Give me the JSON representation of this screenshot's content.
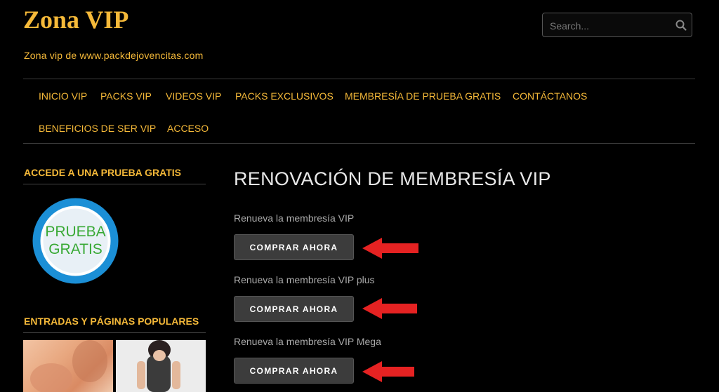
{
  "site": {
    "title": "Zona VIP",
    "tagline": "Zona vip de www.packdejovencitas.com"
  },
  "search": {
    "placeholder": "Search..."
  },
  "nav": {
    "items": [
      "INICIO VIP",
      "PACKS VIP",
      "VIDEOS VIP",
      "PACKS EXCLUSIVOS",
      "MEMBRESÍA DE PRUEBA GRATIS",
      "CONTÁCTANOS",
      "BENEFICIOS DE SER VIP",
      "ACCESO"
    ]
  },
  "sidebar": {
    "trial_widget_title": "ACCEDE A UNA PRUEBA GRATIS",
    "trial_badge_line1": "PRUEBA",
    "trial_badge_line2": "GRATIS",
    "popular_widget_title": "ENTRADAS Y PÁGINAS POPULARES"
  },
  "main": {
    "title": "RENOVACIÓN DE MEMBRESÍA VIP",
    "plans": [
      {
        "label": "Renueva la membresía VIP",
        "button": "COMPRAR AHORA"
      },
      {
        "label": "Renueva la membresía VIP plus",
        "button": "COMPRAR AHORA"
      },
      {
        "label": "Renueva la membresía VIP Mega",
        "button": "COMPRAR AHORA"
      }
    ]
  },
  "colors": {
    "accent": "#f5b939",
    "background": "#000000",
    "button": "#3c3c3c",
    "arrow": "#e52222",
    "badge_ring": "#1b8fd6"
  },
  "icons": {
    "search": "search-icon",
    "arrow": "red-arrow-icon"
  }
}
